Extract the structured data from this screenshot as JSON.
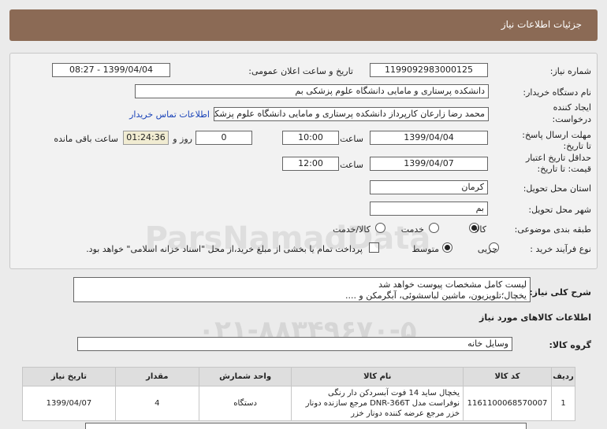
{
  "header": {
    "title": "جزئیات اطلاعات نیاز"
  },
  "form": {
    "need_number_label": "شماره نیاز:",
    "need_number": "1199092983000125",
    "announce_label": "تاریخ و ساعت اعلان عمومی:",
    "announce_value": "1399/04/04 - 08:27",
    "buyer_label": "نام دستگاه خریدار:",
    "buyer_value": "دانشکده پرستاری و مامایی دانشگاه علوم پزشکی بم",
    "creator_label_1": "ایجاد کننده",
    "creator_label_2": "درخواست:",
    "creator_value": "محمد رضا  زارعان  کارپرداز دانشکده پرستاری و مامایی دانشگاه علوم پزشکی بم",
    "contact_link": "اطلاعات تماس خریدار",
    "deadline_label_1": "مهلت ارسال پاسخ:",
    "deadline_label_2": "تا تاریخ:",
    "deadline_date": "1399/04/04",
    "time_label": "ساعت",
    "deadline_time": "10:00",
    "days_value": "0",
    "days_label": "روز و",
    "timer_value": "01:24:36",
    "remaining_label": "ساعت باقی مانده",
    "validity_label_1": "حداقل تاریخ اعتبار",
    "validity_label_2": "قیمت: تا تاریخ:",
    "validity_date": "1399/04/07",
    "validity_time_label": "ساعت",
    "validity_time": "12:00",
    "province_label": "استان محل تحویل:",
    "province_value": "کرمان",
    "city_label": "شهر محل تحویل:",
    "city_value": "بم",
    "category_label": "طبقه بندی موضوعی:",
    "category_options": [
      "کالا",
      "خدمت",
      "کالا/خدمت"
    ],
    "category_selected": "کالا",
    "process_label": "نوع فرآیند خرید :",
    "process_options": [
      "جزیی",
      "متوسط"
    ],
    "process_selected": "متوسط",
    "payment_note": "پرداخت تمام یا بخشی از مبلغ خرید،از محل \"اسناد خزانه اسلامی\" خواهد بود."
  },
  "summary": {
    "label": "شرح کلی نیاز:",
    "line1": "لیست کامل مشخصات پیوست خواهد شد",
    "line2": "یخچال؛تلویزیون، ماشین لباسشوئی، آبگرمکن و ...."
  },
  "goods": {
    "section_title": "اطلاعات کالاهای مورد نیاز",
    "group_label": "گروه کالا:",
    "group_value": "وسایل خانه",
    "columns": [
      "ردیف",
      "کد کالا",
      "نام کالا",
      "واحد شمارش",
      "مقدار",
      "تاریخ نیاز"
    ],
    "rows": [
      {
        "row": "1",
        "code": "1161100068570007",
        "name": "یخچال ساید 14 فوت آبسردکن دار رنگی نوفراست مدل DNR-366T مرجع سازنده دونار خزر مرجع عرضه کننده دونار خزر",
        "unit": "دستگاه",
        "qty": "4",
        "date": "1399/04/07"
      }
    ]
  },
  "watermark": {
    "text1": "ParsNamadData",
    "text2": "۰۲۱-۸۸۳۴۹۶۷۰-۵"
  }
}
